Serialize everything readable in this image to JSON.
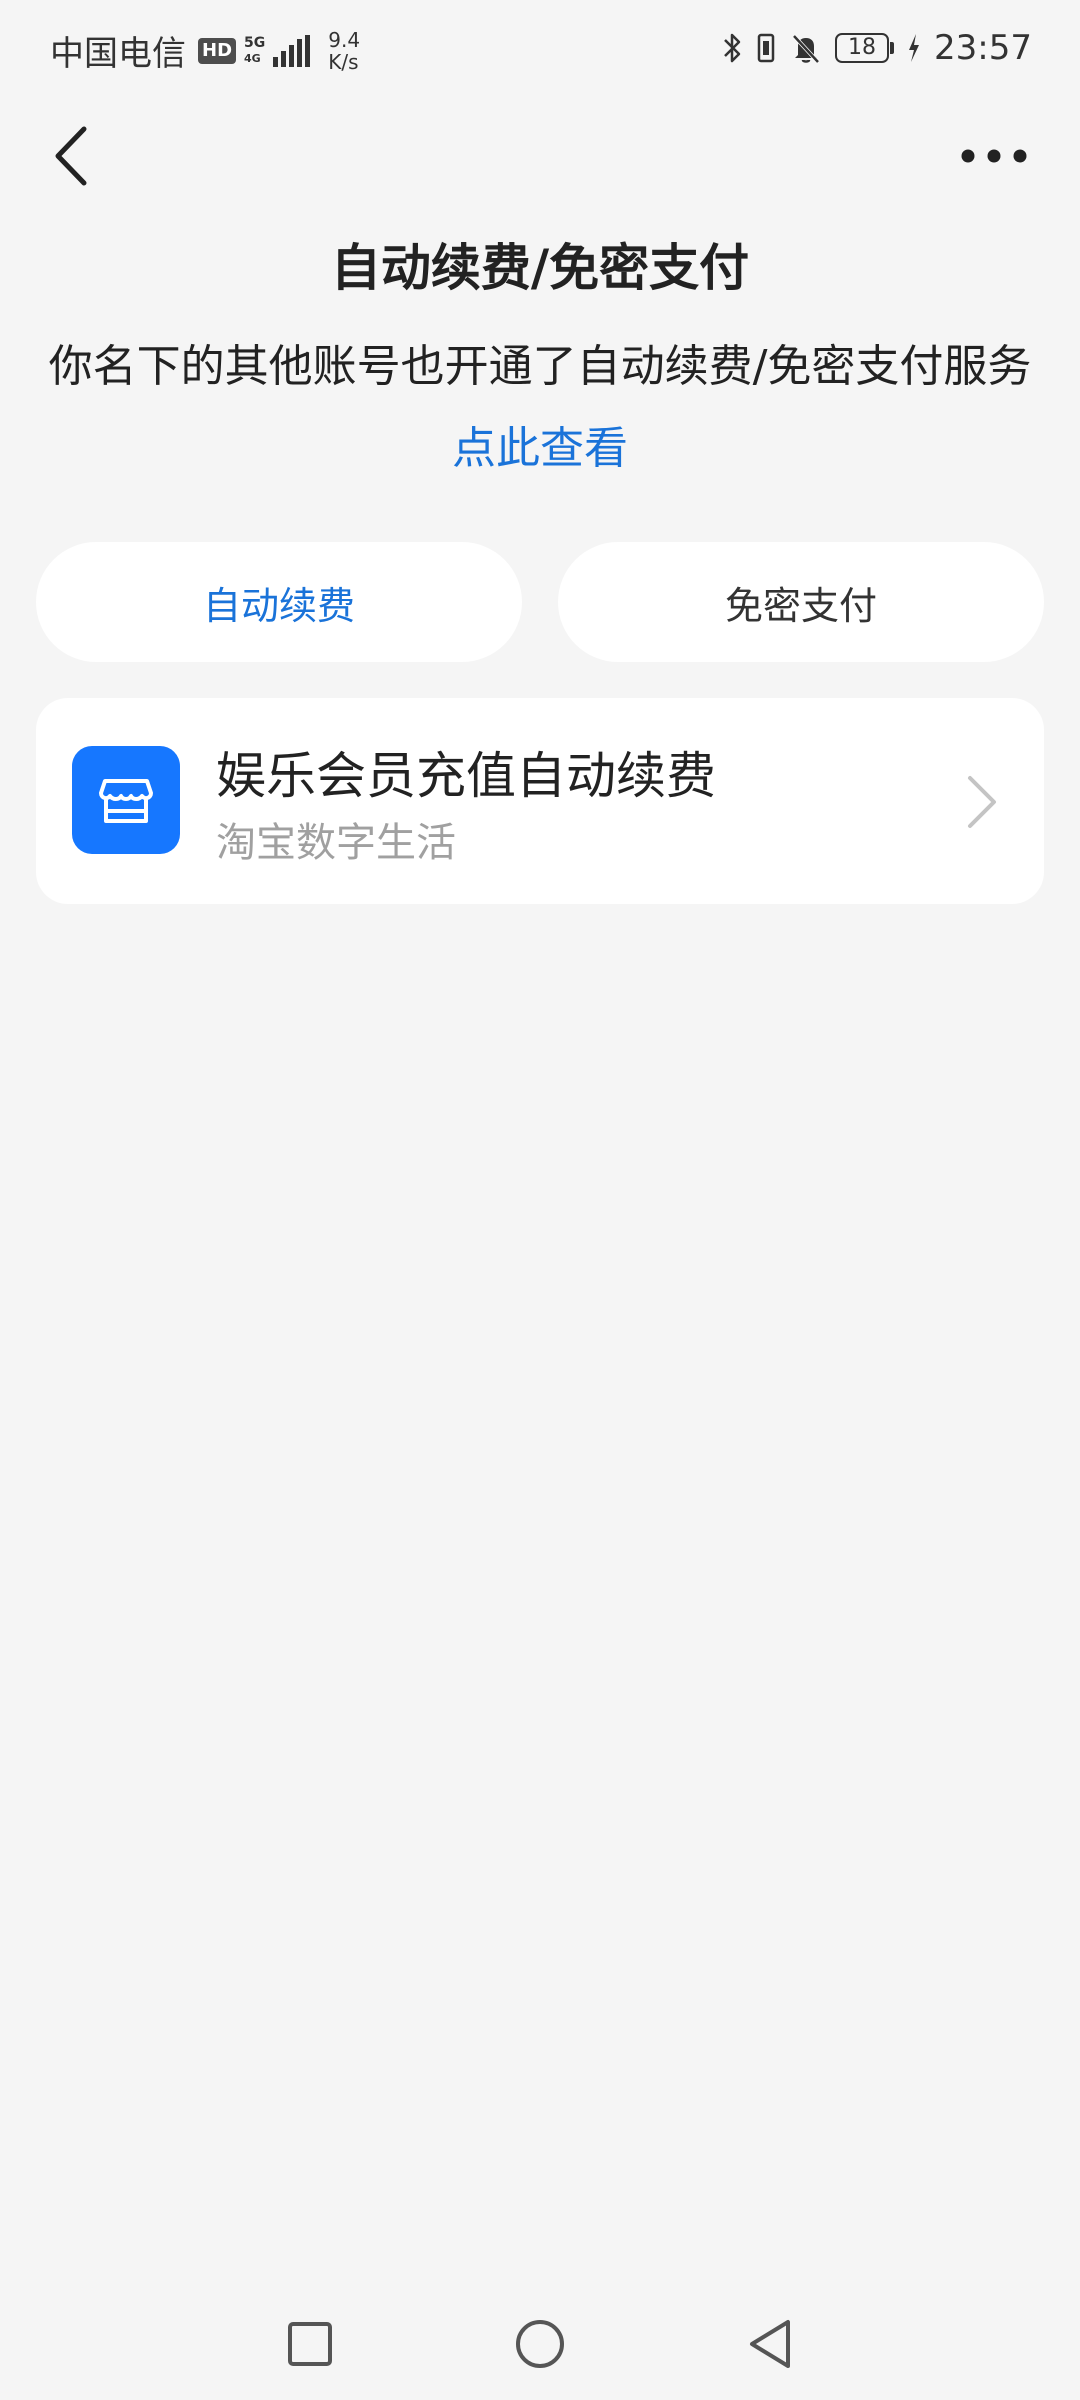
{
  "status_bar": {
    "carrier": "中国电信",
    "hd": "HD",
    "network_top": "5G",
    "network_bottom": "4G",
    "speed_value": "9.4",
    "speed_unit": "K/s",
    "battery": "18",
    "time": "23:57"
  },
  "header": {
    "title": "自动续费/免密支付"
  },
  "notice": {
    "text": "你名下的其他账号也开通了自动续费/免密支付服务",
    "link": "点此查看"
  },
  "tabs": [
    {
      "label": "自动续费",
      "active": true
    },
    {
      "label": "免密支付",
      "active": false
    }
  ],
  "items": [
    {
      "title": "娱乐会员充值自动续费",
      "subtitle": "淘宝数字生活",
      "icon": "store-icon"
    }
  ],
  "colors": {
    "accent": "#1a73d9",
    "icon_bg": "#1677ff",
    "background": "#f5f5f5",
    "card": "#ffffff",
    "subtext": "#a0a0a0"
  }
}
